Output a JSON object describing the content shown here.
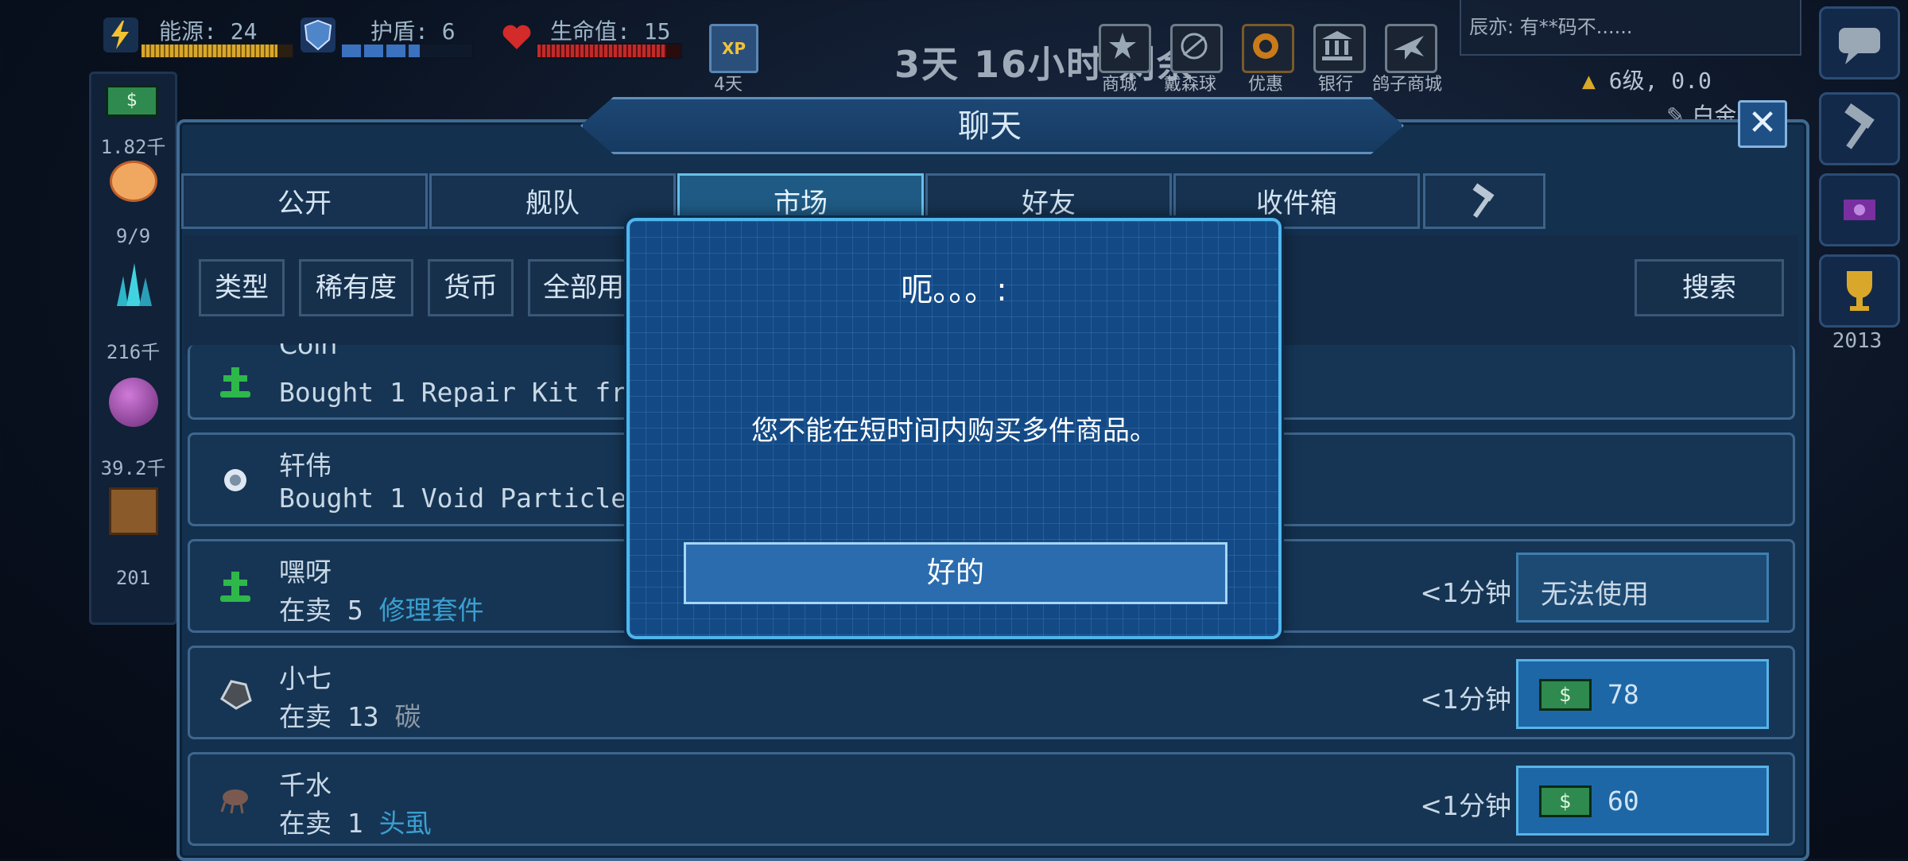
{
  "hud": {
    "energy": "能源: 24",
    "shield": "护盾: 6",
    "life": "生命值: 15",
    "xp_badge": "XP",
    "xp_days": "4天",
    "timer": "3天 16小时 剩余",
    "nav": [
      {
        "label": "商城",
        "icon": "star-icon"
      },
      {
        "label": "戴森球",
        "icon": "sphere-icon"
      },
      {
        "label": "优惠",
        "icon": "deal-icon"
      },
      {
        "label": "银行",
        "icon": "bank-icon"
      },
      {
        "label": "鸽子商城",
        "icon": "plane-icon"
      }
    ],
    "chat_preview": "辰亦: 有**码不......",
    "level": "6级, 0.0",
    "gold_label": "白金",
    "bars": {
      "energy_fraction": 0.9,
      "shield_fraction": 0.6,
      "life_fraction": 0.9
    }
  },
  "left_resources": [
    {
      "icon": "money-icon",
      "value": "1.82千"
    },
    {
      "icon": "crew-icon",
      "value": "9/9"
    },
    {
      "icon": "crystal-icon",
      "value": "216千"
    },
    {
      "icon": "orb-icon",
      "value": "39.2千"
    },
    {
      "icon": "cargo-icon",
      "value": "201"
    }
  ],
  "right_panel": {
    "trophy_value": "2013"
  },
  "chat": {
    "title": "聊天",
    "close": "✕",
    "tabs": [
      "公开",
      "舰队",
      "市场",
      "好友",
      "收件箱"
    ],
    "active_tab": "市场",
    "filters": [
      "类型",
      "稀有度",
      "货币",
      "全部用"
    ],
    "search": "搜索",
    "rows": [
      {
        "name": "Coin",
        "desc": "Bought 1 Repair Kit fro",
        "icon": "repair-kit-icon"
      },
      {
        "name": "轩伟",
        "desc": "Bought 1 Void Particle",
        "icon": "void-particle-icon"
      },
      {
        "name": "嘿呀",
        "desc_prefix": "在卖 5",
        "item": "修理套件",
        "time": "<1分钟",
        "action": "无法使用",
        "icon": "repair-kit-icon"
      },
      {
        "name": "小七",
        "desc_prefix": "在卖 13",
        "item": "碳",
        "time": "<1分钟",
        "price": "78",
        "icon": "carbon-icon"
      },
      {
        "name": "千水",
        "desc_prefix": "在卖 1",
        "item": "头虱",
        "time": "<1分钟",
        "price": "60",
        "icon": "louse-icon"
      }
    ]
  },
  "dialog": {
    "title": "呃。。。:",
    "message": "您不能在短时间内购买多件商品。",
    "ok": "好的"
  },
  "colors": {
    "panel_bg": "#13304f",
    "dialog_bg": "#134a86",
    "accent": "#4fb6ea",
    "item_link": "#3b9fd0",
    "money_green": "#2f8a4f"
  }
}
